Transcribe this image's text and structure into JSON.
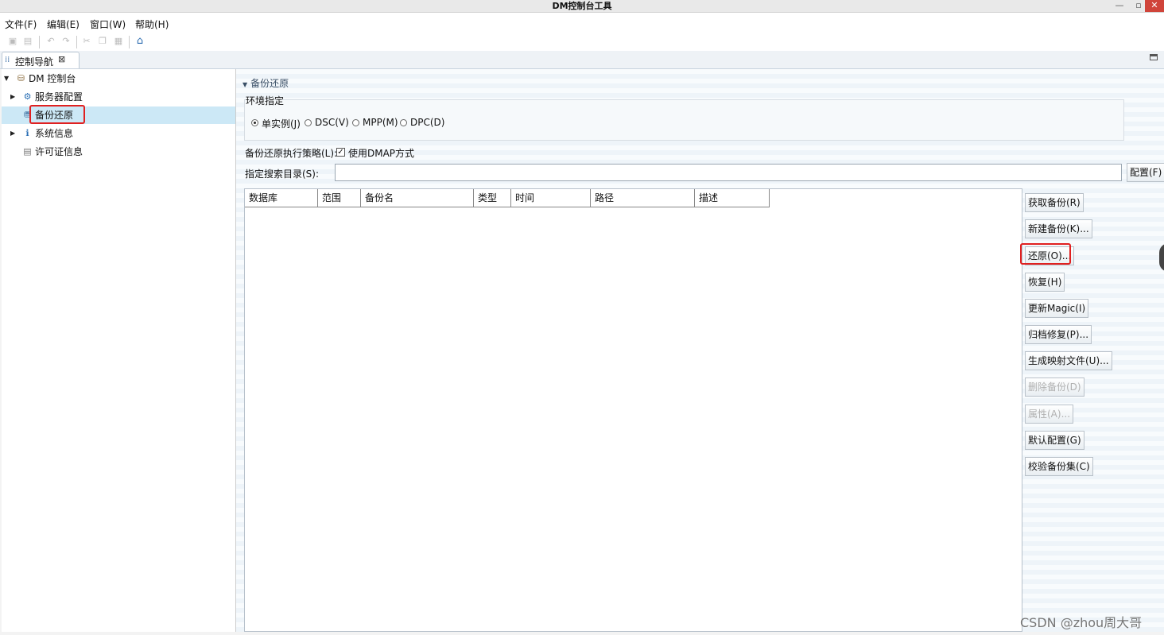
{
  "window": {
    "title": "DM控制台工具"
  },
  "menu": [
    "文件(F)",
    "编辑(E)",
    "窗口(W)",
    "帮助(H)"
  ],
  "tab": {
    "label": "控制导航",
    "close": "⊠"
  },
  "tree": {
    "root": "DM 控制台",
    "items": [
      "服务器配置",
      "备份还原",
      "系统信息",
      "许可证信息"
    ]
  },
  "section": {
    "title": "备份还原"
  },
  "env": {
    "legend": "环境指定",
    "options": [
      "单实例(J)",
      "DSC(V)",
      "MPP(M)",
      "DPC(D)"
    ],
    "selected": "单实例(J)"
  },
  "strategy": {
    "label": "备份还原执行策略(L):",
    "checkbox_label": "使用DMAP方式",
    "checked": true
  },
  "search": {
    "label": "指定搜索目录(S):",
    "value": "",
    "config_button": "配置(F)"
  },
  "table": {
    "columns": [
      "数据库",
      "范围",
      "备份名",
      "类型",
      "时间",
      "路径",
      "描述"
    ]
  },
  "actions": [
    {
      "label": "获取备份(R)",
      "enabled": true
    },
    {
      "label": "新建备份(K)...",
      "enabled": true
    },
    {
      "label": "还原(O)...",
      "enabled": true
    },
    {
      "label": "恢复(H)",
      "enabled": true
    },
    {
      "label": "更新Magic(I)",
      "enabled": true
    },
    {
      "label": "归档修复(P)...",
      "enabled": true
    },
    {
      "label": "生成映射文件(U)...",
      "enabled": true
    },
    {
      "label": "删除备份(D)",
      "enabled": false
    },
    {
      "label": "属性(A)...",
      "enabled": false
    },
    {
      "label": "默认配置(G)",
      "enabled": true
    },
    {
      "label": "校验备份集(C)",
      "enabled": true
    }
  ],
  "watermark": "CSDN @zhou周大哥",
  "colors": {
    "selection": "#cce8f6",
    "highlight_box": "#e02020",
    "close_button": "#d0443a"
  }
}
